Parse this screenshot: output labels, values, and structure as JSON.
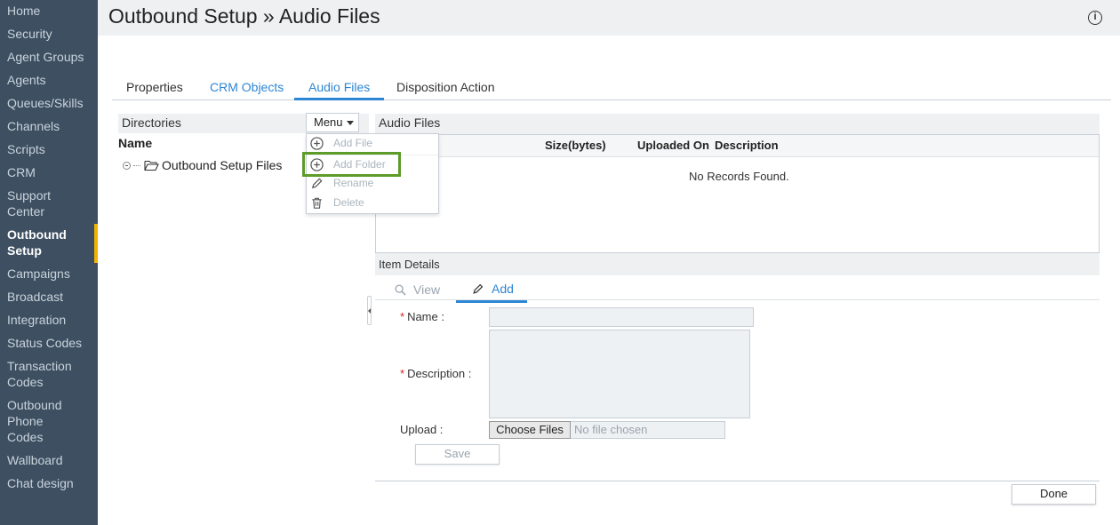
{
  "sidebar": {
    "items": [
      {
        "label": "Home"
      },
      {
        "label": "Security"
      },
      {
        "label": "Agent Groups"
      },
      {
        "label": "Agents"
      },
      {
        "label": "Queues/Skills"
      },
      {
        "label": "Channels"
      },
      {
        "label": "Scripts"
      },
      {
        "label": "CRM"
      },
      {
        "label": "Support Center"
      },
      {
        "label": "Outbound Setup",
        "active": true
      },
      {
        "label": "Campaigns"
      },
      {
        "label": "Broadcast"
      },
      {
        "label": "Integration"
      },
      {
        "label": "Status Codes"
      },
      {
        "label": "Transaction Codes"
      },
      {
        "label": "Outbound Phone Codes"
      },
      {
        "label": "Wallboard"
      },
      {
        "label": "Chat design"
      }
    ]
  },
  "header": {
    "title": "Outbound Setup » Audio Files",
    "info_icon": "info-icon"
  },
  "tabs": [
    {
      "label": "Properties"
    },
    {
      "label": "CRM Objects"
    },
    {
      "label": "Audio Files",
      "active": true
    },
    {
      "label": "Disposition Action"
    }
  ],
  "directories": {
    "title": "Directories",
    "menu_label": "Menu",
    "name_column": "Name",
    "tree_root": "Outbound Setup Files"
  },
  "menu": {
    "items": [
      {
        "label": "Add File",
        "icon": "plus-circle-icon"
      },
      {
        "label": "Add Folder",
        "icon": "plus-circle-icon",
        "highlighted": true
      },
      {
        "label": "Rename",
        "icon": "pencil-icon"
      },
      {
        "label": "Delete",
        "icon": "trash-icon"
      }
    ],
    "highlight_color": "#5d9b2a"
  },
  "audio_files": {
    "title": "Audio Files",
    "columns": [
      "Size(bytes)",
      "Uploaded On",
      "Description"
    ],
    "empty_text": "No Records Found."
  },
  "item_details": {
    "title": "Item Details",
    "tabs": [
      {
        "label": "View",
        "icon": "search-icon"
      },
      {
        "label": "Add",
        "icon": "pencil-icon",
        "active": true
      }
    ],
    "fields": {
      "name_label": "Name :",
      "description_label": "Description :",
      "upload_label": "Upload :",
      "name_value": "",
      "description_value": "",
      "choose_files_label": "Choose Files",
      "no_file_text": "No file chosen"
    },
    "save_label": "Save"
  },
  "footer": {
    "done_label": "Done"
  },
  "colors": {
    "sidebar_bg": "#3d4f61",
    "accent": "#2d86d3",
    "active_marker": "#f0b400"
  }
}
